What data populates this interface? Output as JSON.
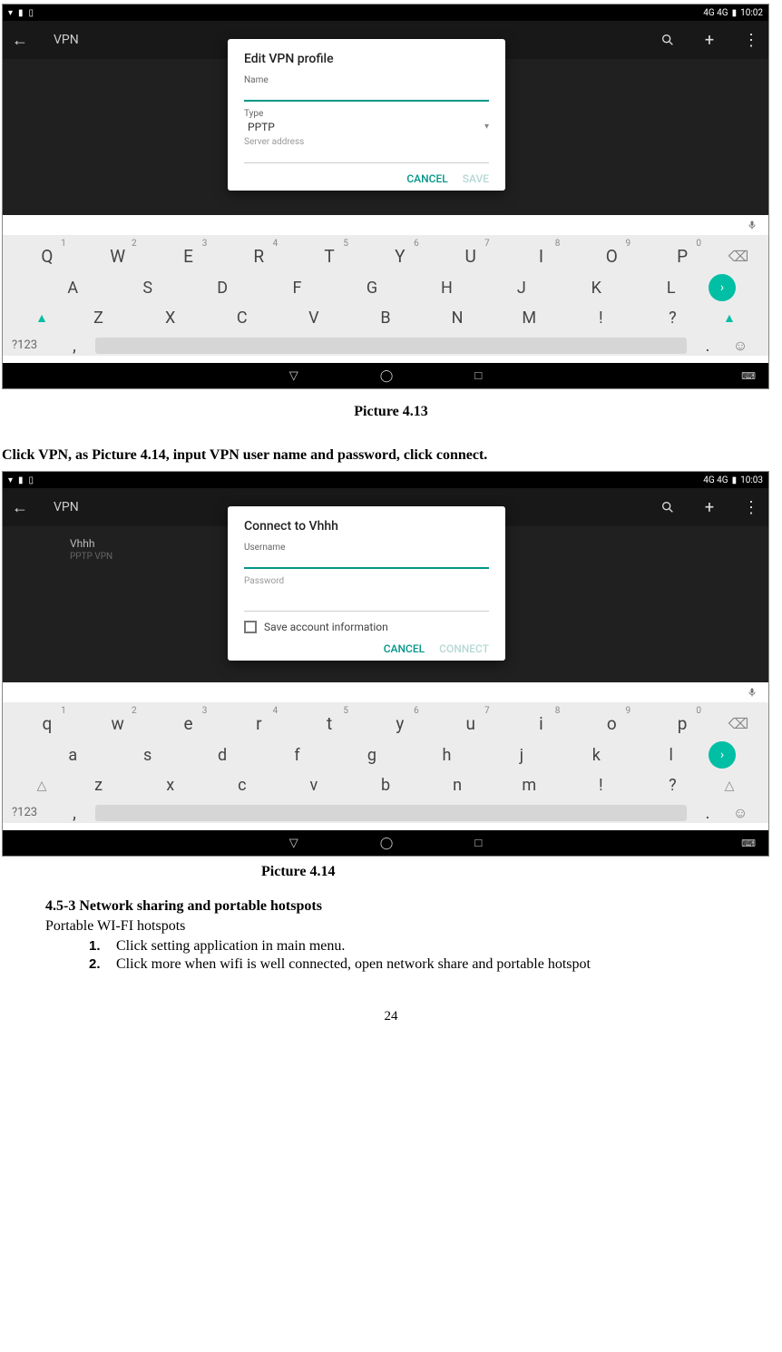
{
  "page_number": "24",
  "captions": {
    "p413": "Picture 4.13",
    "p414": "Picture 4.14"
  },
  "instruction_414": "Click VPN, as Picture 4.14, input VPN user name and password, click connect.",
  "section": {
    "heading": "4.5-3 Network sharing and portable hotspots",
    "sub": "Portable WI-FI hotspots",
    "items": [
      "Click setting application in main menu.",
      "Click more when wifi is well connected, open network share and portable hotspot"
    ],
    "nums": [
      "1.",
      "2."
    ]
  },
  "screenshot1": {
    "status_time": "10:02",
    "status_net": "4G  4G",
    "title": "VPN",
    "dialog_title": "Edit VPN profile",
    "name_label": "Name",
    "type_label": "Type",
    "type_value": "PPTP",
    "server_label": "Server address",
    "cancel": "CANCEL",
    "save": "SAVE",
    "kb_sym": "?123",
    "row1": [
      "Q",
      "W",
      "E",
      "R",
      "T",
      "Y",
      "U",
      "I",
      "O",
      "P"
    ],
    "row1_sup": [
      "1",
      "2",
      "3",
      "4",
      "5",
      "6",
      "7",
      "8",
      "9",
      "0"
    ],
    "row2": [
      "A",
      "S",
      "D",
      "F",
      "G",
      "H",
      "J",
      "K",
      "L"
    ],
    "row3": [
      "Z",
      "X",
      "C",
      "V",
      "B",
      "N",
      "M",
      "!",
      "?"
    ]
  },
  "screenshot2": {
    "status_time": "10:03",
    "status_net": "4G  4G",
    "title": "VPN",
    "vpn_name": "Vhhh",
    "vpn_sub": "PPTP VPN",
    "dialog_title": "Connect to Vhhh",
    "username_label": "Username",
    "password_label": "Password",
    "save_info": "Save account information",
    "cancel": "CANCEL",
    "connect": "CONNECT",
    "kb_sym": "?123",
    "row1": [
      "q",
      "w",
      "e",
      "r",
      "t",
      "y",
      "u",
      "i",
      "o",
      "p"
    ],
    "row1_sup": [
      "1",
      "2",
      "3",
      "4",
      "5",
      "6",
      "7",
      "8",
      "9",
      "0"
    ],
    "row2": [
      "a",
      "s",
      "d",
      "f",
      "g",
      "h",
      "j",
      "k",
      "l"
    ],
    "row3": [
      "z",
      "x",
      "c",
      "v",
      "b",
      "n",
      "m",
      "!",
      "?"
    ]
  }
}
